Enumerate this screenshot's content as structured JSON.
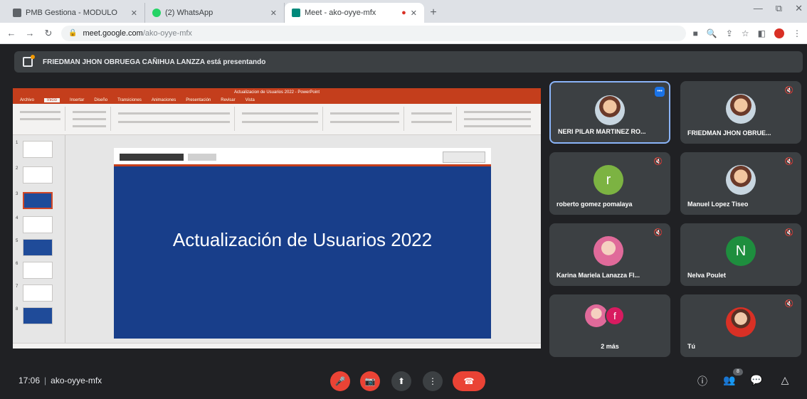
{
  "browser": {
    "tabs": [
      {
        "title": "PMB Gestiona - MODULO",
        "icon_color": "#5f6368"
      },
      {
        "title": "(2) WhatsApp",
        "icon_color": "#25d366"
      },
      {
        "title": "Meet - ako-oyye-mfx",
        "icon_color": "#00897b"
      }
    ],
    "new_tab_label": "+",
    "window_controls": [
      "—",
      "⧉",
      "✕"
    ],
    "url": "meet.google.com",
    "url_path": "/ako-oyye-mfx",
    "nav": {
      "back": "←",
      "forward": "→",
      "reload": "↻"
    }
  },
  "banner": {
    "text": "FRIEDMAN JHON OBRUEGA CAÑIHUA LANZZA está presentando",
    "icon": "present-screen-icon"
  },
  "presentation": {
    "app_title": "Actualizacion de Usuarios 2022 - PowerPoint",
    "ribbon_tabs": [
      "Archivo",
      "Inicio",
      "Insertar",
      "Diseño",
      "Transiciones",
      "Animaciones",
      "Presentación",
      "Revisar",
      "Vista"
    ],
    "slide_title": "Actualización de Usuarios 2022",
    "thumbnail_numbers": [
      "1",
      "2",
      "3",
      "4",
      "5",
      "6",
      "7",
      "8"
    ]
  },
  "participants": [
    {
      "name": "NERI PILAR MARTINEZ RO...",
      "avatar": "photo",
      "speaking": true
    },
    {
      "name": "FRIEDMAN JHON OBRUE...",
      "avatar": "photo"
    },
    {
      "name": "roberto gomez pomalaya",
      "avatar": "letter",
      "letter": "r",
      "color": "#7cb342"
    },
    {
      "name": "Manuel Lopez Tiseo",
      "avatar": "photo"
    },
    {
      "name": "Karina Mariela Lanazza Fl...",
      "avatar": "photo"
    },
    {
      "name": "Nelva Poulet",
      "avatar": "letter",
      "letter": "N",
      "color": "#1e8e3e"
    },
    {
      "name": "2 más",
      "avatar": "group",
      "letter": "f",
      "color": "#d81b60"
    },
    {
      "name": "Tú",
      "avatar": "photo"
    }
  ],
  "bottom": {
    "time": "17:06",
    "separator": "|",
    "meeting_code": "ako-oyye-mfx",
    "controls": {
      "mic": "🎤",
      "camera": "📷",
      "present": "⬆",
      "more": "⋮",
      "end": "☎"
    },
    "right": {
      "info": "ⓘ",
      "people": "👥",
      "people_count": "8",
      "chat": "💬",
      "activities": "△"
    }
  }
}
